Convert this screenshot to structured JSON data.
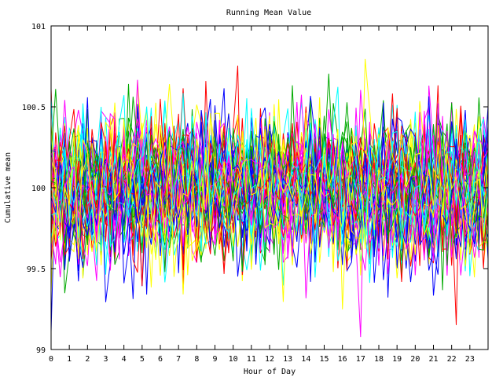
{
  "chart_data": {
    "type": "line",
    "title": "Running Mean Value",
    "xlabel": "Hour of Day",
    "ylabel": "Cumulative mean",
    "xlim": [
      0,
      24
    ],
    "ylim": [
      99,
      101
    ],
    "x_ticks": [
      0,
      1,
      2,
      3,
      4,
      5,
      6,
      7,
      8,
      9,
      10,
      11,
      12,
      13,
      14,
      15,
      16,
      17,
      18,
      19,
      20,
      21,
      22,
      23
    ],
    "y_ticks": [
      99,
      99.5,
      100,
      100.5,
      101
    ],
    "y_tick_labels": [
      "99",
      "99.5",
      "100",
      "100.5",
      "101"
    ],
    "grid": false,
    "legend": "none",
    "series_count": 60,
    "points_per_series": 97,
    "series_mean": 100,
    "series_spread": 0.22,
    "observed_range": [
      99.0,
      100.85
    ],
    "colors": [
      "#ff0000",
      "#00aa00",
      "#0000ff",
      "#ff00ff",
      "#00ffff",
      "#ffff00"
    ]
  }
}
